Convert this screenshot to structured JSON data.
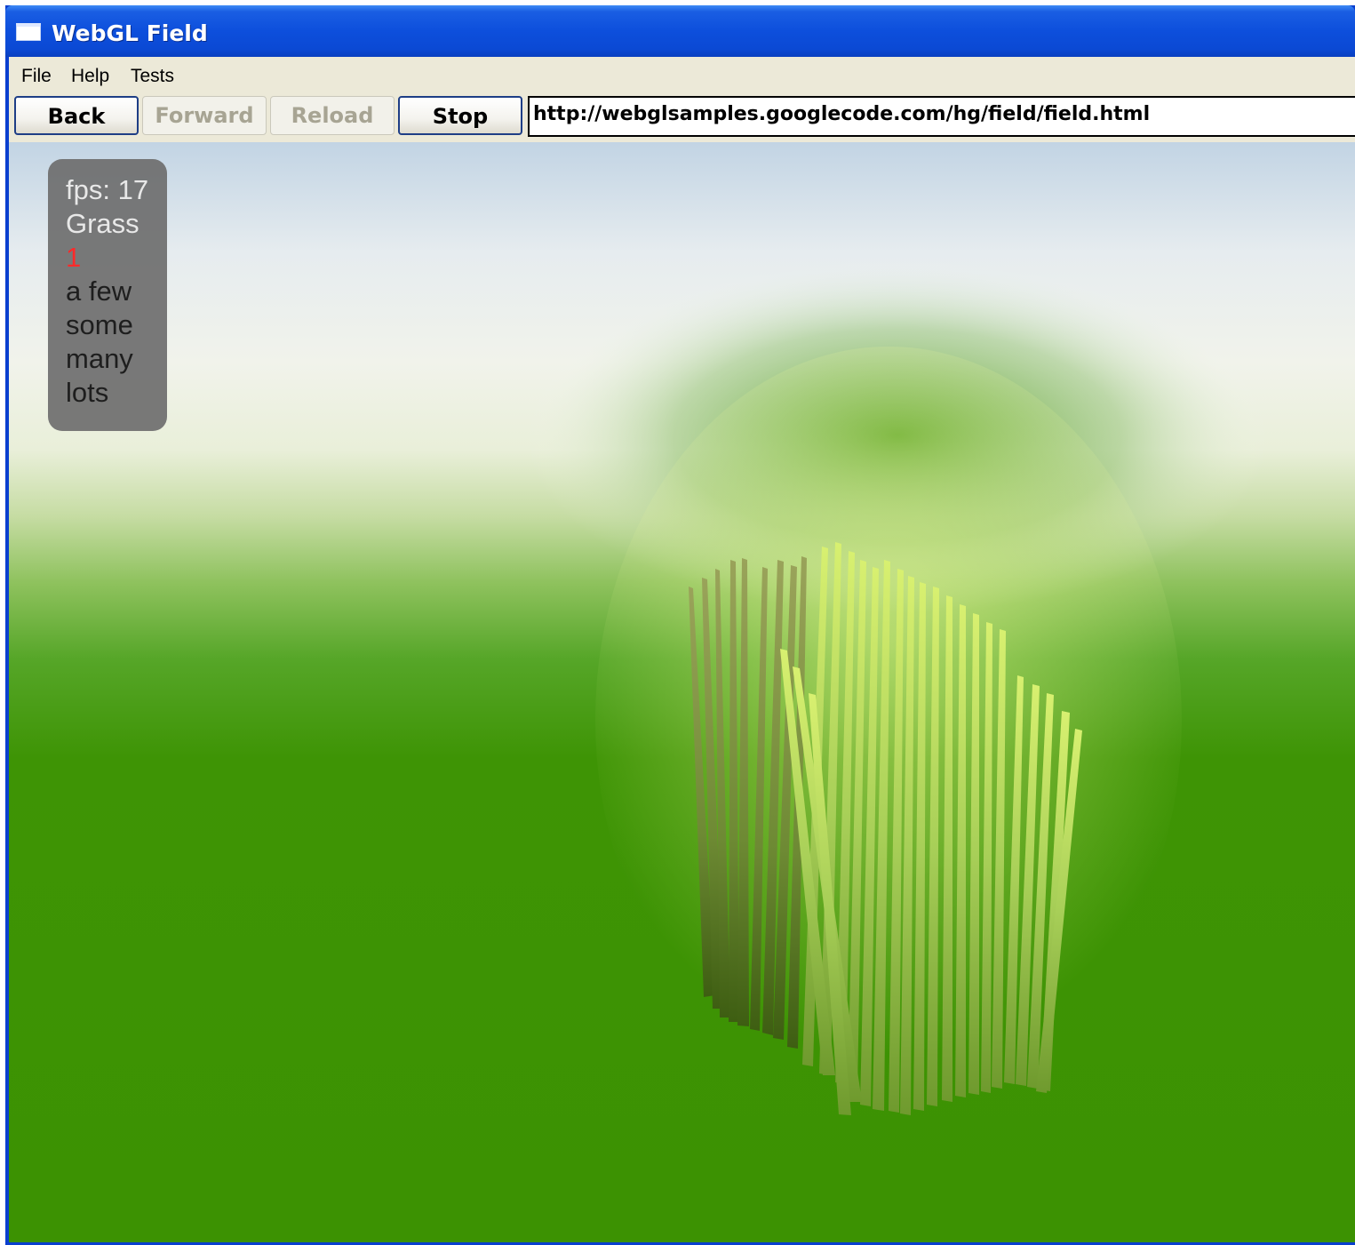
{
  "window": {
    "title": "WebGL Field",
    "icon": "window-icon",
    "accent_color": "#0b4fd8"
  },
  "menu": {
    "items": [
      "File",
      "Help",
      "Tests"
    ]
  },
  "toolbar": {
    "back_label": "Back",
    "forward_label": "Forward",
    "reload_label": "Reload",
    "stop_label": "Stop",
    "url": "http://webglsamples.googlecode.com/hg/field/field.html"
  },
  "hud": {
    "fps": "fps: 17",
    "heading": "Grass",
    "options": [
      "1",
      "a few",
      "some",
      "many",
      "lots"
    ],
    "selected_option": "1"
  },
  "scene": {
    "sky_color": "#e8eef0",
    "ground_color": "#3c9202",
    "grass_color": "#c8e86a"
  }
}
